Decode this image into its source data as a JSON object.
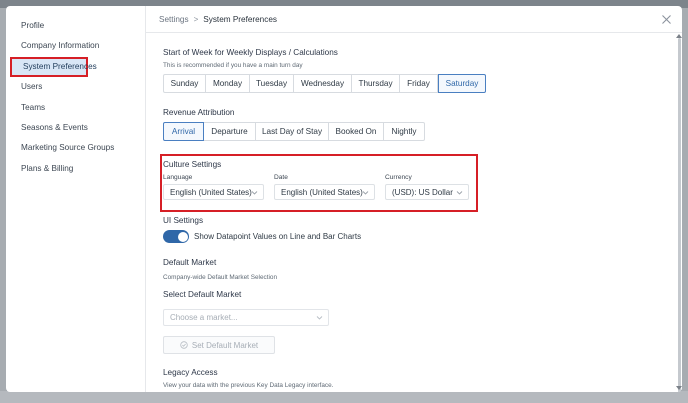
{
  "sidebar": {
    "items": [
      {
        "label": "Profile"
      },
      {
        "label": "Company Information"
      },
      {
        "label": "System Preferences"
      },
      {
        "label": "Users"
      },
      {
        "label": "Teams"
      },
      {
        "label": "Seasons & Events"
      },
      {
        "label": "Marketing Source Groups"
      },
      {
        "label": "Plans & Billing"
      }
    ],
    "active_index": 2
  },
  "header": {
    "crumb_parent": "Settings",
    "crumb_separator": ">",
    "crumb_current": "System Preferences",
    "close_icon": "close-icon"
  },
  "week_start": {
    "title": "Start of Week for Weekly Displays / Calculations",
    "subtitle": "This is recommended if you have a main turn day",
    "options": [
      "Sunday",
      "Monday",
      "Tuesday",
      "Wednesday",
      "Thursday",
      "Friday",
      "Saturday"
    ],
    "selected": "Saturday"
  },
  "revenue": {
    "title": "Revenue Attribution",
    "options": [
      "Arrival",
      "Departure",
      "Last Day of Stay",
      "Booked On",
      "Nightly"
    ],
    "selected": "Arrival"
  },
  "culture": {
    "title": "Culture Settings",
    "language_label": "Language",
    "language_value": "English (United States)",
    "date_label": "Date",
    "date_value": "English (United States)",
    "currency_label": "Currency",
    "currency_value": "(USD): US Dollar"
  },
  "ui_settings": {
    "title": "UI Settings",
    "toggle_label": "Show Datapoint Values on Line and Bar Charts",
    "toggle_on": true
  },
  "default_market": {
    "title": "Default Market",
    "subtitle": "Company-wide Default Market Selection",
    "select_title": "Select Default Market",
    "placeholder": "Choose a market...",
    "button_label": "Set Default Market"
  },
  "legacy": {
    "title": "Legacy Access",
    "subtitle": "View your data with the previous Key Data Legacy interface."
  },
  "colors": {
    "accent": "#2f67a8",
    "highlight_box": "#d61f26",
    "active_bg": "#d9e6f6"
  }
}
